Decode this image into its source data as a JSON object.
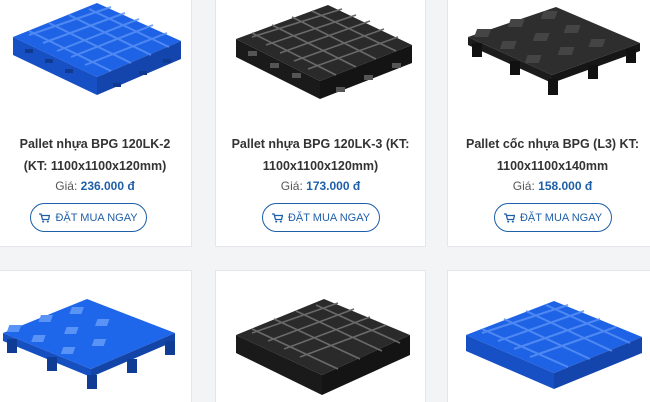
{
  "products": [
    {
      "name": "Pallet nhựa BPG 120LK-2 (KT: 1100x1100x120mm)",
      "price_label": "Giá:",
      "price": "236.000 đ",
      "button": "ĐẶT MUA NGAY",
      "color": "#1e63e6"
    },
    {
      "name": "Pallet nhựa BPG 120LK-3 (KT: 1100x1100x120mm)",
      "price_label": "Giá:",
      "price": "173.000 đ",
      "button": "ĐẶT MUA NGAY",
      "color": "#2a2a2a"
    },
    {
      "name": "Pallet cốc nhựa BPG (L3) KT: 1100x1100x140mm",
      "price_label": "Giá:",
      "price": "158.000 đ",
      "button": "ĐẶT MUA NGAY",
      "color": "#2e2e2e"
    },
    {
      "color": "#1e66ea"
    },
    {
      "color": "#2a2a2a"
    },
    {
      "color": "#1e63e6"
    }
  ],
  "colors": {
    "accent": "#1f5fa8",
    "border": "#e4e6ea"
  },
  "icons": {
    "button_icon": "cart-icon"
  }
}
